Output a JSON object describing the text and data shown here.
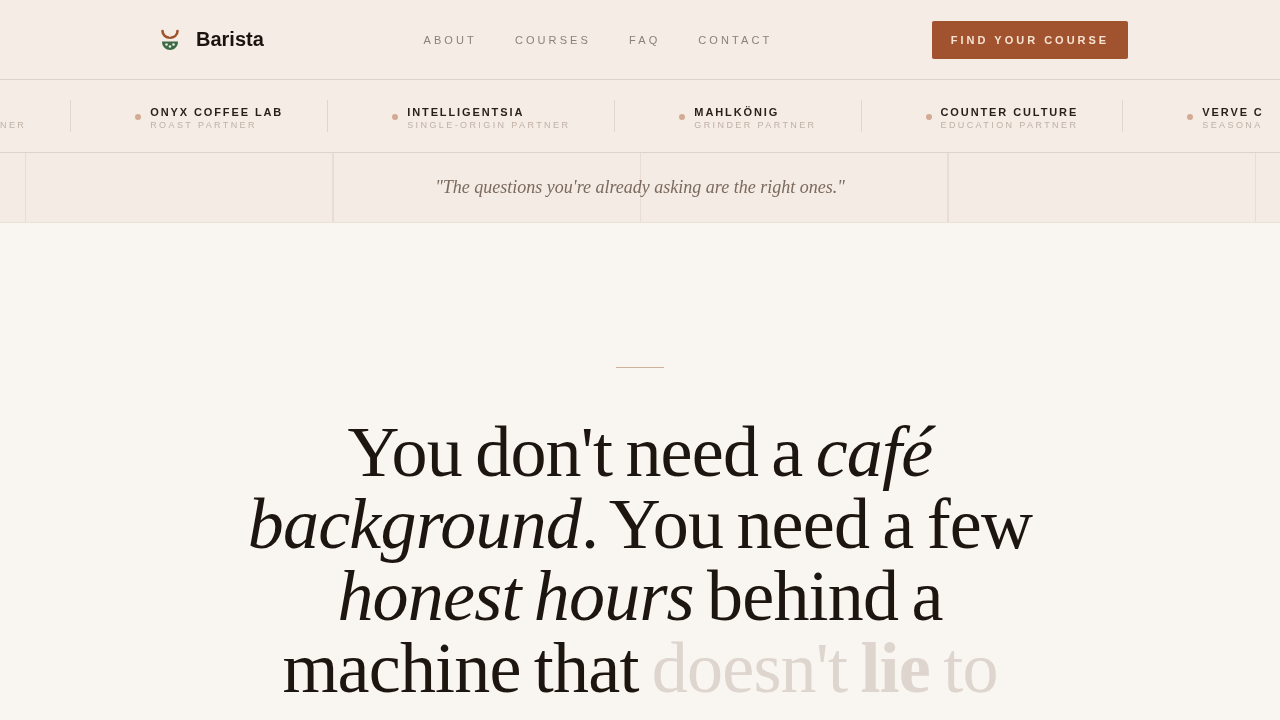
{
  "header": {
    "brand": "Barista",
    "nav": [
      "ABOUT",
      "COURSES",
      "FAQ",
      "CONTACT"
    ],
    "cta": "FIND YOUR COURSE"
  },
  "partners": [
    {
      "sub": "NER"
    },
    {
      "name": "ONYX COFFEE LAB",
      "sub": "ROAST PARTNER"
    },
    {
      "name": "INTELLIGENTSIA",
      "sub": "SINGLE-ORIGIN PARTNER"
    },
    {
      "name": "MAHLKÖNIG",
      "sub": "GRINDER PARTNER"
    },
    {
      "name": "COUNTER CULTURE",
      "sub": "EDUCATION PARTNER"
    },
    {
      "name": "VERVE C",
      "sub": "SEASONA"
    }
  ],
  "quote": "\"The questions you're already asking are the right ones.\"",
  "headline": [
    {
      "text": "You don't need a *café background*. You need a few *honest hours* behind a machine that",
      "revealed": true
    },
    {
      "text": "doesn't **lie** to",
      "revealed": false
    }
  ]
}
